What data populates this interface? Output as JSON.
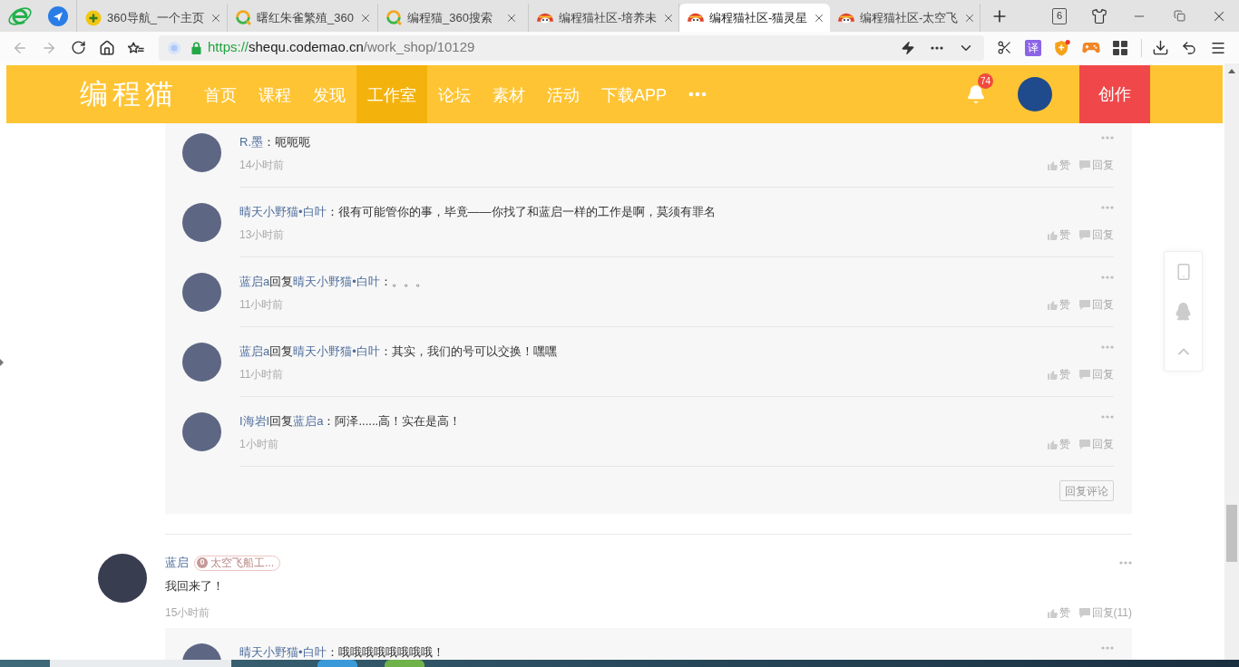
{
  "browser": {
    "tabs": [
      {
        "kind": "portal",
        "title": "360导航_一个主页",
        "selected": false
      },
      {
        "kind": "search",
        "title": "曙红朱雀繁殖_360",
        "selected": false
      },
      {
        "kind": "search",
        "title": "编程猫_360搜索",
        "selected": false
      },
      {
        "kind": "community",
        "title": "编程猫社区-培养未",
        "selected": false
      },
      {
        "kind": "community",
        "title": "编程猫社区-猫灵星",
        "selected": true
      },
      {
        "kind": "community",
        "title": "编程猫社区-太空飞",
        "selected": false
      }
    ],
    "tab_count": "6",
    "back": {
      "disabled": true
    },
    "forward": {
      "disabled": true
    },
    "url": {
      "scheme": "https://",
      "host": "shequ.codemao.cn",
      "path": "/work_shop/10129"
    },
    "translate": "译"
  },
  "site_nav": {
    "logo": "编程猫",
    "items": [
      {
        "label": "首页",
        "selected": false
      },
      {
        "label": "课程",
        "selected": false
      },
      {
        "label": "发现",
        "selected": false
      },
      {
        "label": "工作室",
        "selected": true
      },
      {
        "label": "论坛",
        "selected": false
      },
      {
        "label": "素材",
        "selected": false
      },
      {
        "label": "活动",
        "selected": false
      },
      {
        "label": "下载APP",
        "selected": false
      }
    ],
    "notifications": "74",
    "create_button": "创作"
  },
  "comments": [
    {
      "replies": [
        {
          "author": "R.墨",
          "text": "：呃呃呃",
          "time": "14小时前",
          "like": "赞",
          "reply": "回复"
        },
        {
          "author": "晴天小野猫•白叶",
          "text": "：很有可能管你的事，毕竟——你找了和蓝启一样的工作是啊，莫须有罪名",
          "time": "13小时前",
          "like": "赞",
          "reply": "回复"
        },
        {
          "author": "蓝启a",
          "reply_word": "回复",
          "reply_to": "晴天小野猫•白叶",
          "text": "：。。。",
          "time": "11小时前",
          "like": "赞",
          "reply": "回复"
        },
        {
          "author": "蓝启a",
          "reply_word": "回复",
          "reply_to": "晴天小野猫•白叶",
          "text": "：其实，我们的号可以交换！嘿嘿",
          "time": "11小时前",
          "like": "赞",
          "reply": "回复"
        },
        {
          "author": "I海岩I",
          "reply_word": "回复",
          "reply_to": "蓝启a",
          "text": "：阿泽......高！实在是高！",
          "time": "1小时前",
          "like": "赞",
          "reply": "回复"
        }
      ],
      "reply_button": "回复评论"
    },
    {
      "author": "蓝启",
      "badge": {
        "level": "0",
        "label": "太空飞船工..."
      },
      "text": "我回来了！",
      "time": "15小时前",
      "like": "赞",
      "reply": "回复(11)",
      "replies": [
        {
          "author": "晴天小野猫•白叶",
          "text": "：哦哦哦哦哦哦哦哦！"
        }
      ]
    }
  ]
}
